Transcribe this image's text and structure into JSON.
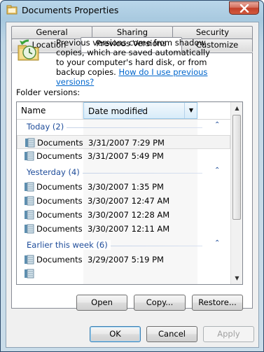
{
  "window": {
    "title": "Documents Properties"
  },
  "tabs": {
    "row1": [
      "General",
      "Sharing",
      "Security"
    ],
    "row2": [
      "Location",
      "Previous Versions",
      "Customize"
    ],
    "active": "Previous Versions"
  },
  "info": {
    "text": "Previous versions come from shadow copies, which are saved automatically to your computer's hard disk, or from backup copies. ",
    "link": "How do I use previous versions?"
  },
  "folder_versions_label": "Folder versions:",
  "columns": {
    "name": "Name",
    "date": "Date modified"
  },
  "groups": [
    {
      "label": "Today (2)",
      "rows": [
        {
          "name": "Documents",
          "date": "3/31/2007 7:29 PM"
        },
        {
          "name": "Documents",
          "date": "3/31/2007 5:49 PM"
        }
      ]
    },
    {
      "label": "Yesterday (4)",
      "rows": [
        {
          "name": "Documents",
          "date": "3/30/2007 1:35 PM"
        },
        {
          "name": "Documents",
          "date": "3/30/2007 12:47 AM"
        },
        {
          "name": "Documents",
          "date": "3/30/2007 12:28 AM"
        },
        {
          "name": "Documents",
          "date": "3/30/2007 12:11 AM"
        }
      ]
    },
    {
      "label": "Earlier this week (6)",
      "rows": [
        {
          "name": "Documents",
          "date": "3/29/2007 5:19 PM"
        }
      ]
    }
  ],
  "actions": {
    "open": "Open",
    "copy": "Copy...",
    "restore": "Restore..."
  },
  "dialog_buttons": {
    "ok": "OK",
    "cancel": "Cancel",
    "apply": "Apply"
  },
  "icons": {
    "title": "folder-properties-icon",
    "close": "close-icon",
    "info": "restore-folder-icon",
    "row": "folder-icon"
  }
}
